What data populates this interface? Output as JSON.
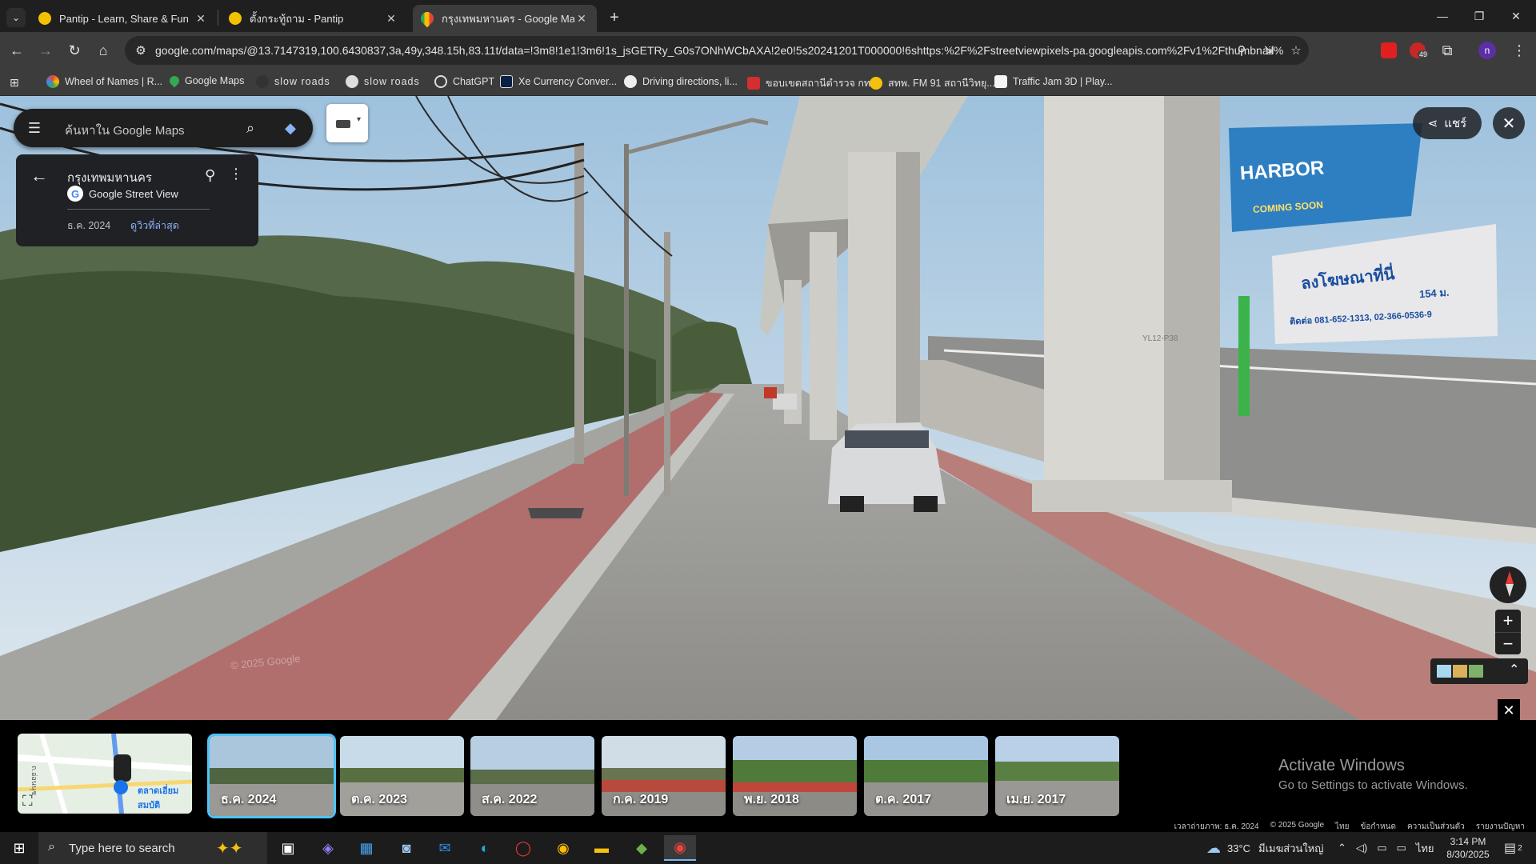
{
  "browser": {
    "tabs": [
      {
        "title": "Pantip - Learn, Share & Fun",
        "active": false
      },
      {
        "title": "ตั้งกระทู้ถาม - Pantip",
        "active": false
      },
      {
        "title": "กรุงเทพมหานคร - Google Maps",
        "active": true
      }
    ],
    "url": "google.com/maps/@13.7147319,100.6430837,3a,49y,348.15h,83.11t/data=!3m8!1e1!3m6!1s_jsGETRy_G0s7ONhWCbAXA!2e0!5s20241201T000000!6shttps:%2F%2Fstreetviewpixels-pa.googleapis.com%2Fv1%2Fthumbnail%3F...",
    "bookmarks": [
      "Wheel of Names | R...",
      "Google Maps",
      "slow roads",
      "slow roads",
      "ChatGPT",
      "Xe Currency Conver...",
      "Driving directions, li...",
      "ขอบเขตสถานีตำรวจ กท...",
      "สทพ. FM 91 สถานีวิทยุ...",
      "Traffic Jam 3D | Play..."
    ],
    "profile_initial": "n",
    "extension_badge": "49"
  },
  "maps": {
    "search_placeholder": "ค้นหาใน Google Maps",
    "place_title": "กรุงเทพมหานคร",
    "source_label": "Google Street View",
    "capture_date": "ธ.ค. 2024",
    "latest_link": "ดูวิวที่ล่าสุด",
    "share_label": "แชร์",
    "scene_texts": {
      "watermark": "© 2025 Google",
      "pillar_code": "YL12-P38",
      "billboard_left": "HARBOR",
      "billboard_left_sub": "COMING SOON",
      "billboard_right": "ลงโฆษณาที่นี่",
      "billboard_right_line1": "154 ม.",
      "billboard_right_line2": "ติดต่อ 081-652-1313, 02-366-0536-9"
    }
  },
  "timeline": {
    "thumbnails": [
      "ธ.ค. 2024",
      "ต.ค. 2023",
      "ส.ค. 2022",
      "ก.ค. 2019",
      "พ.ย. 2018",
      "ต.ค. 2017",
      "เม.ย. 2017"
    ],
    "minimap_label": "ตลาดเอี่ยมสมบัติ",
    "minimap_road": "ถ.อ่อนนุช",
    "activate_title": "Activate Windows",
    "activate_sub": "Go to Settings to activate Windows.",
    "footer": [
      "เวลาถ่ายภาพ: ธ.ค. 2024",
      "© 2025 Google",
      "ไทย",
      "ข้อกำหนด",
      "ความเป็นส่วนตัว",
      "รายงานปัญหา"
    ]
  },
  "taskbar": {
    "search_placeholder": "Type here to search",
    "weather": "33°C",
    "weather_desc": "มีเมฆส่วนใหญ่",
    "lang": "ไทย",
    "time": "3:14 PM",
    "date": "8/30/2025",
    "notifications": "2"
  },
  "colors": {
    "chrome_dark": "#1f1f1f",
    "chrome_mid": "#3c3c3c",
    "maps_panel": "#202124",
    "link_blue": "#8ab4f8",
    "timeline_highlight": "#4fc3f7"
  }
}
